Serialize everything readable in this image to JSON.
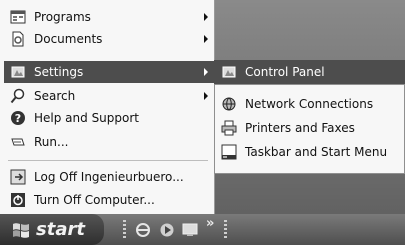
{
  "start_menu": {
    "items": [
      {
        "label": "Programs",
        "icon": "programs-icon",
        "has_submenu": true
      },
      {
        "label": "Documents",
        "icon": "documents-icon",
        "has_submenu": true
      },
      {
        "label": "Settings",
        "icon": "settings-icon",
        "has_submenu": true,
        "highlighted": true
      },
      {
        "label": "Search",
        "icon": "search-icon",
        "has_submenu": true
      },
      {
        "label": "Help and Support",
        "icon": "help-icon",
        "has_submenu": false
      },
      {
        "label": "Run...",
        "icon": "run-icon",
        "has_submenu": false
      }
    ],
    "bottom_items": [
      {
        "label": "Log Off Ingenieurbuero...",
        "icon": "log-off-icon"
      },
      {
        "label": "Turn Off Computer...",
        "icon": "power-icon"
      }
    ]
  },
  "settings_submenu": {
    "highlighted_item": {
      "label": "Control Panel",
      "icon": "control-panel-icon"
    },
    "items": [
      {
        "label": "Network Connections",
        "icon": "network-icon"
      },
      {
        "label": "Printers and Faxes",
        "icon": "printer-icon"
      },
      {
        "label": "Taskbar and Start Menu",
        "icon": "taskbar-icon"
      }
    ]
  },
  "taskbar": {
    "start_label": "start",
    "overflow_chevron": "»",
    "quick_launch": [
      "ie-icon",
      "media-icon",
      "desktop-icon"
    ]
  },
  "colors": {
    "highlight": "#4d4d4d",
    "menu_bg": "#f7f7f7",
    "taskbar": "#4f4f4f"
  }
}
